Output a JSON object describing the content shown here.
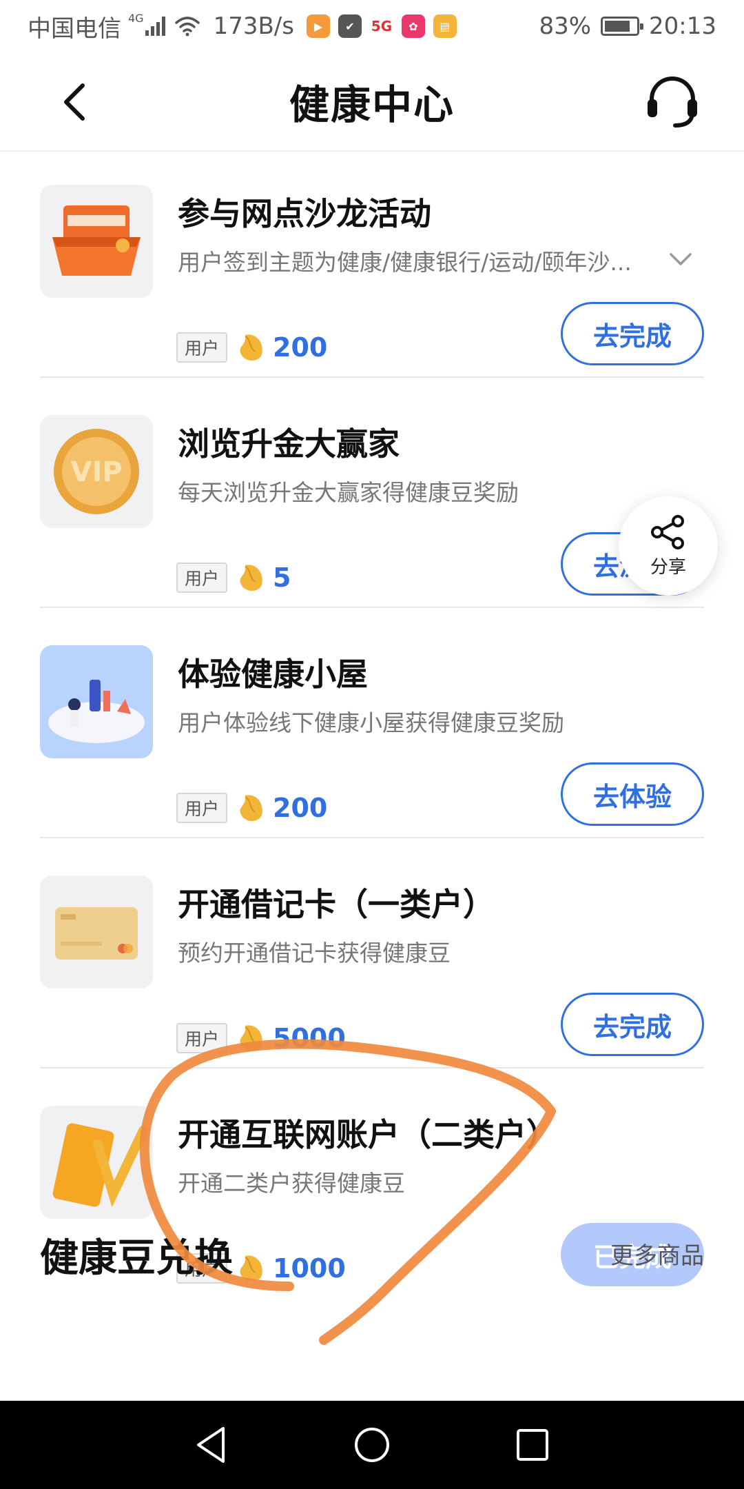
{
  "status_bar": {
    "carrier": "中国电信",
    "network_type": "4G",
    "speed": "173B/s",
    "network_badge": "5G",
    "battery": "83%",
    "time": "20:13"
  },
  "nav": {
    "title": "健康中心"
  },
  "tasks": [
    {
      "title": "参与网点沙龙活动",
      "description": "用户签到主题为健康/健康银行/运动/颐年沙...",
      "tag": "用户",
      "points": "200",
      "action": "去完成",
      "thumb_icon": "calendar-basket-icon"
    },
    {
      "title": "浏览升金大赢家",
      "description": "每天浏览升金大赢家得健康豆奖励",
      "tag": "用户",
      "points": "5",
      "action": "去浏览",
      "thumb_icon": "vip-coin-icon"
    },
    {
      "title": "体验健康小屋",
      "description": "用户体验线下健康小屋获得健康豆奖励",
      "tag": "用户",
      "points": "200",
      "action": "去体验",
      "thumb_icon": "health-hut-icon"
    },
    {
      "title": "开通借记卡（一类户）",
      "description": "预约开通借记卡获得健康豆",
      "tag": "用户",
      "points": "5000",
      "action": "去完成",
      "thumb_icon": "debit-card-icon"
    },
    {
      "title": "开通互联网账户（二类户）",
      "description": "开通二类户获得健康豆",
      "tag": "用户",
      "points": "1000",
      "action": "已完成",
      "thumb_icon": "internet-card-icon"
    }
  ],
  "share": {
    "label": "分享"
  },
  "section": {
    "title": "健康豆兑换",
    "more": "更多商品"
  },
  "colors": {
    "accent": "#2f6fe0",
    "done_button": "#b3c8fb",
    "annotation_stroke": "#f0893e"
  }
}
